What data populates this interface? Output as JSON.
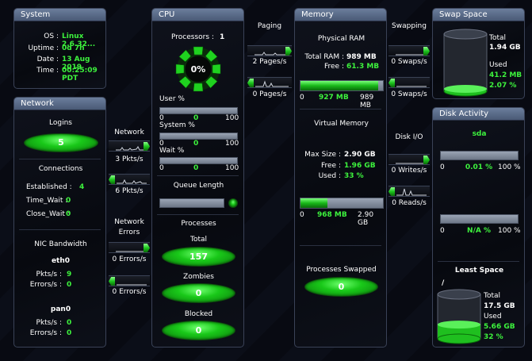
{
  "system": {
    "title": "System",
    "os_label": "OS :",
    "os_value": "Linux 2.6.32...",
    "uptime_label": "Uptime :",
    "uptime_value": "0d 7h",
    "date_label": "Date :",
    "date_value": "13 Aug 2019",
    "time_label": "Time :",
    "time_value": "00:25:09 PDT"
  },
  "network": {
    "title": "Network",
    "logins_label": "Logins",
    "logins_value": "5",
    "connections_label": "Connections",
    "established_label": "Established :",
    "established_value": "4",
    "time_wait_label": "Time_Wait :",
    "time_wait_value": "0",
    "close_wait_label": "Close_Wait :",
    "close_wait_value": "0",
    "nic_label": "NIC Bandwidth",
    "eth0_name": "eth0",
    "eth0_pkts_label": "Pkts/s :",
    "eth0_pkts": "9",
    "eth0_err_label": "Errors/s :",
    "eth0_err": "0",
    "pan0_name": "pan0",
    "pan0_pkts_label": "Pkts/s :",
    "pan0_pkts": "0",
    "pan0_err_label": "Errors/s :",
    "pan0_err": "0"
  },
  "links": {
    "network_label": "Network",
    "net_in": "3 Pkts/s",
    "net_out": "6 Pkts/s",
    "net_errors_label_1": "Network",
    "net_errors_label_2": "Errors",
    "err_in": "0 Errors/s",
    "err_out": "0 Errors/s",
    "paging_label": "Paging",
    "page_in": "2 Pages/s",
    "page_out": "0 Pages/s",
    "swapping_label": "Swapping",
    "swap_in": "0 Swaps/s",
    "swap_out": "0 Swaps/s",
    "diskio_label": "Disk I/O",
    "writes": "0 Writes/s",
    "reads": "0 Reads/s"
  },
  "cpu": {
    "title": "CPU",
    "processors_label": "Processors :",
    "processors_value": "1",
    "usage_percent": "0%",
    "user_label": "User %",
    "system_label": "System %",
    "wait_label": "Wait %",
    "user_fill": 0,
    "system_fill": 0,
    "wait_fill": 0,
    "scale_min": "0",
    "scale_mid": "0",
    "scale_max": "100",
    "queue_label": "Queue Length",
    "processes_label": "Processes",
    "total_label": "Total",
    "total_value": "157",
    "zombies_label": "Zombies",
    "zombies_value": "0",
    "blocked_label": "Blocked",
    "blocked_value": "0"
  },
  "memory": {
    "title": "Memory",
    "physical_label": "Physical RAM",
    "total_ram_label": "Total RAM :",
    "total_ram_value": "989 MB",
    "free_label": "Free :",
    "free_value": "61.3 MB",
    "phys_min": "0",
    "phys_used": "927 MB",
    "phys_max": "989 MB",
    "phys_fill": 0.94,
    "virtual_label": "Virtual Memory",
    "max_size_label": "Max Size :",
    "max_size_value": "2.90 GB",
    "vfree_label": "Free :",
    "vfree_value": "1.96 GB",
    "vused_label": "Used :",
    "vused_value": "33 %",
    "virt_min": "0",
    "virt_used": "968 MB",
    "virt_max": "2.90 GB",
    "virt_fill": 0.33,
    "swapped_label": "Processes Swapped",
    "swapped_value": "0"
  },
  "swap": {
    "title": "Swap Space",
    "total_label": "Total",
    "total_value": "1.94 GB",
    "used_label": "Used",
    "used_value": "41.2 MB",
    "used_pct": "2.07 %",
    "fill": 0.02
  },
  "disk": {
    "title": "Disk Activity",
    "device": "sda",
    "bar1_min": "0",
    "bar1_val": "0.01 %",
    "bar1_max": "100 %",
    "bar2_min": "0",
    "bar2_val": "N/A %",
    "bar2_max": "100 %",
    "least_label": "Least Space",
    "mount": "/",
    "total_label": "Total",
    "total_value": "17.5 GB",
    "used_label": "Used",
    "used_value": "5.66 GB",
    "used_pct": "32 %",
    "fill": 0.32
  },
  "colors": {
    "accent_green": "#3df23d",
    "title_bar": "#5b6c8a",
    "panel_border": "#3a4257"
  }
}
